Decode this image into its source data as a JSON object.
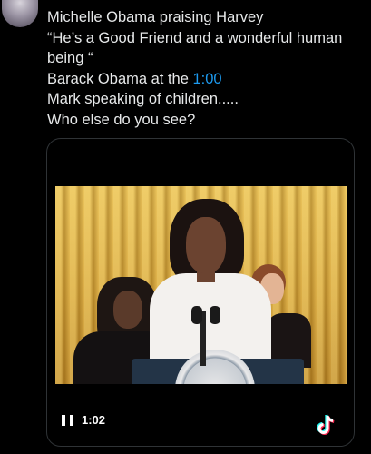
{
  "tweet": {
    "lines": [
      "Michelle Obama praising Harvey",
      "“He’s a Good Friend and a wonderful human",
      "being “",
      "Barack Obama at the ",
      "Mark speaking of children.....",
      "Who else do you see?"
    ],
    "timestamp_link": "1:00"
  },
  "video": {
    "time": "1:02",
    "play_state": "paused",
    "icons": {
      "pause": "pause-icon",
      "watermark": "tiktok-icon"
    }
  },
  "colors": {
    "background": "#000000",
    "text": "#e7e9ea",
    "link": "#1d9bf0",
    "card_border": "#2f3336"
  }
}
